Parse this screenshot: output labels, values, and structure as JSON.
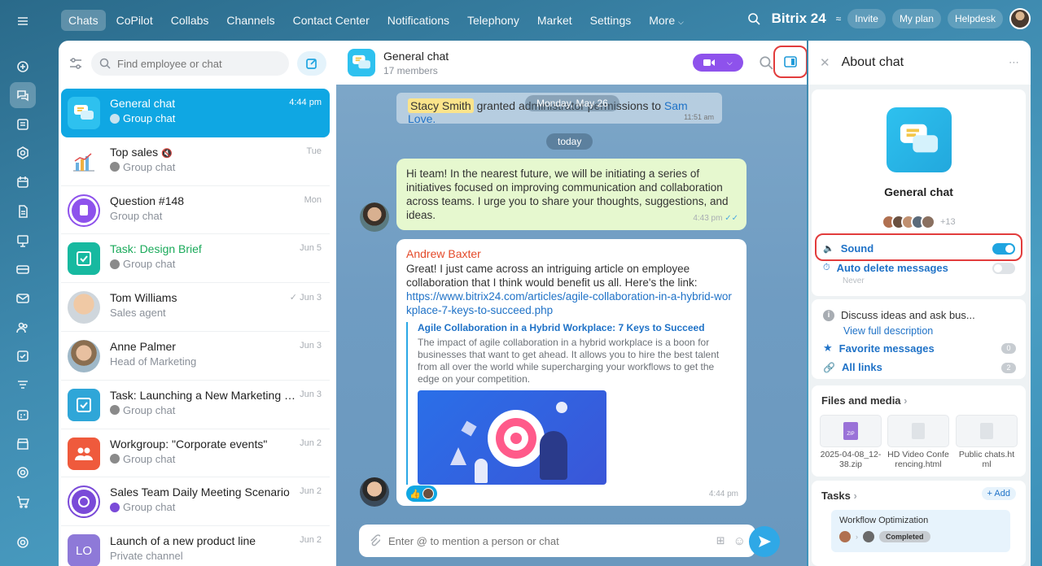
{
  "nav": {
    "tabs": [
      "Chats",
      "CoPilot",
      "Collabs",
      "Channels",
      "Contact Center",
      "Notifications",
      "Telephony",
      "Market",
      "Settings",
      "More"
    ],
    "active": "Chats"
  },
  "topright": {
    "logo": "Bitrix 24",
    "invite": "Invite",
    "myplan": "My plan",
    "helpdesk": "Helpdesk"
  },
  "left": {
    "search_placeholder": "Find employee or chat",
    "chats": [
      {
        "name": "General chat",
        "sub": "Group chat",
        "date": "4:44 pm"
      },
      {
        "name": "Top sales",
        "sub": "Group chat",
        "date": "Tue"
      },
      {
        "name": "Question #148",
        "sub": "Group chat",
        "date": "Mon"
      },
      {
        "name": "Task: Design Brief",
        "sub": "Group chat",
        "date": "Jun 5"
      },
      {
        "name": "Tom Williams",
        "sub": "Sales agent",
        "date": "Jun 3"
      },
      {
        "name": "Anne Palmer",
        "sub": "Head of Marketing",
        "date": "Jun 3"
      },
      {
        "name": "Task: Launching a New Marketing C...",
        "sub": "Group chat",
        "date": "Jun 3"
      },
      {
        "name": "Workgroup: \"Corporate events\"",
        "sub": "Group chat",
        "date": "Jun 2"
      },
      {
        "name": "Sales Team Daily Meeting Scenario",
        "sub": "Group chat",
        "date": "Jun 2"
      },
      {
        "name": "Launch of a new product line",
        "sub": "Private channel",
        "date": "Jun 2"
      }
    ],
    "lo_initials": "LO"
  },
  "chat": {
    "title": "General chat",
    "members": "17 members",
    "sys_user1": "Stacy Smith",
    "sys_text": "granted administrator permissions to",
    "sys_user2": "Sam Love.",
    "sys_time": "11:51 am",
    "date_old": "Monday, May 26",
    "date_today": "today",
    "msg1": "Hi team! In the nearest future, we will be initiating a series of initiatives focused on improving communication and collaboration across teams. I urge you to share your thoughts, suggestions, and ideas.",
    "msg1_time": "4:43 pm",
    "msg2_author": "Andrew Baxter",
    "msg2_text": "Great! I just came across an intriguing article on employee collaboration that I think would benefit us all. Here's the link:",
    "msg2_link": "https://www.bitrix24.com/articles/agile-collaboration-in-a-hybrid-workplace-7-keys-to-succeed.php",
    "preview_title": "Agile Collaboration in a Hybrid Workplace: 7 Keys to Succeed",
    "preview_text": "The impact of agile collaboration in a hybrid workplace is a boon for businesses that want to get ahead. It allows you to hire the best talent from all over the world while supercharging your workflows to get the edge on your competition.",
    "msg2_time": "4:44 pm",
    "input_placeholder": "Enter @ to mention a person or chat"
  },
  "about": {
    "title": "About chat",
    "chat_name": "General chat",
    "more_members": "+13",
    "sound": "Sound",
    "auto_delete": "Auto delete messages",
    "never": "Never",
    "description": "Discuss ideas and ask bus...",
    "view_desc": "View full description",
    "favorites": "Favorite messages",
    "favorites_count": "0",
    "links": "All links",
    "links_count": "2",
    "files_title": "Files and media",
    "files": [
      "2025-04-08_12-38.zip",
      "HD Video Conferencing.html",
      "Public chats.html"
    ],
    "zip_label": "ZIP",
    "tasks_title": "Tasks",
    "add": "+ Add",
    "task_name": "Workflow Optimization",
    "task_status": "Completed"
  },
  "colors": {
    "accent": "#0fa7e3",
    "video": "#8e52ec",
    "highlight": "#e23c3c",
    "link": "#1f72c7"
  }
}
